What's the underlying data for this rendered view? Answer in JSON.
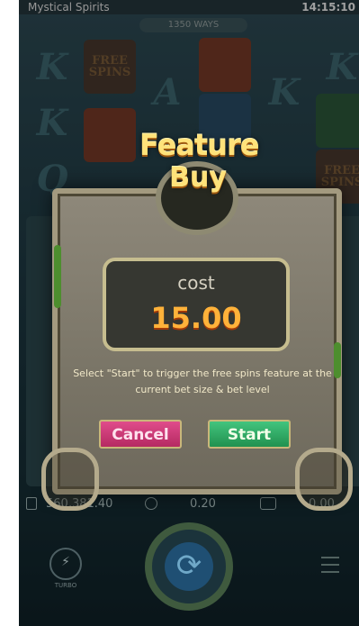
{
  "status_bar": {
    "app_title": "Mystical Spirits",
    "time": "14:15:10"
  },
  "ways_label": "1350 WAYS",
  "reels": {
    "symbols": [
      "K",
      "A",
      "K",
      "K",
      "K",
      "Q",
      "FREE SPINS",
      "FREE SPINS"
    ]
  },
  "feature_buy": {
    "title_line1": "Feature",
    "title_line2": "Buy",
    "cost_label": "cost",
    "cost_value": "15.00",
    "description": "Select \"Start\" to trigger the free spins feature at the current bet size & bet level",
    "cancel_label": "Cancel",
    "start_label": "Start"
  },
  "bottom_bar": {
    "balance": "560,381.40",
    "bet": "0.20",
    "win": "0.00"
  },
  "turbo_label": "TURBO",
  "spin_icon": "refresh-icon"
}
